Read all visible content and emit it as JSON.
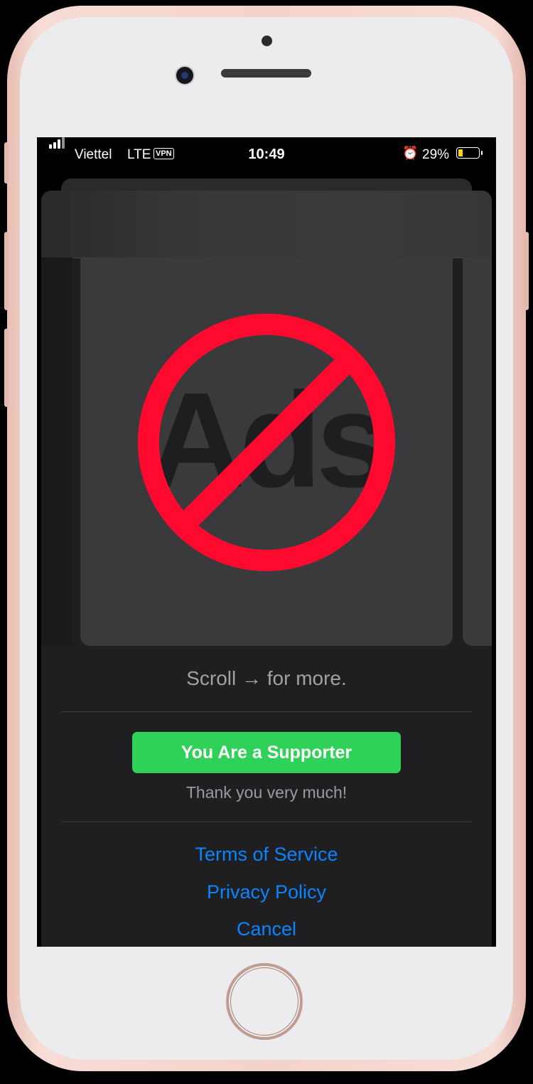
{
  "status_bar": {
    "carrier": "Viettel",
    "network": "LTE",
    "vpn": "VPN",
    "time": "10:49",
    "battery": "29%",
    "battery_level": 0.29
  },
  "card": {
    "ad_text": "Ads",
    "icon": "no-ads-icon"
  },
  "scroll_hint": "Scroll → for more.",
  "supporter_button": "You Are a Supporter",
  "thanks_text": "Thank you very much!",
  "links": {
    "terms": "Terms of Service",
    "privacy": "Privacy Policy",
    "cancel": "Cancel"
  },
  "colors": {
    "accent_green": "#30d158",
    "link_blue": "#0a84ff",
    "prohibit_red": "#ff0a2e"
  }
}
